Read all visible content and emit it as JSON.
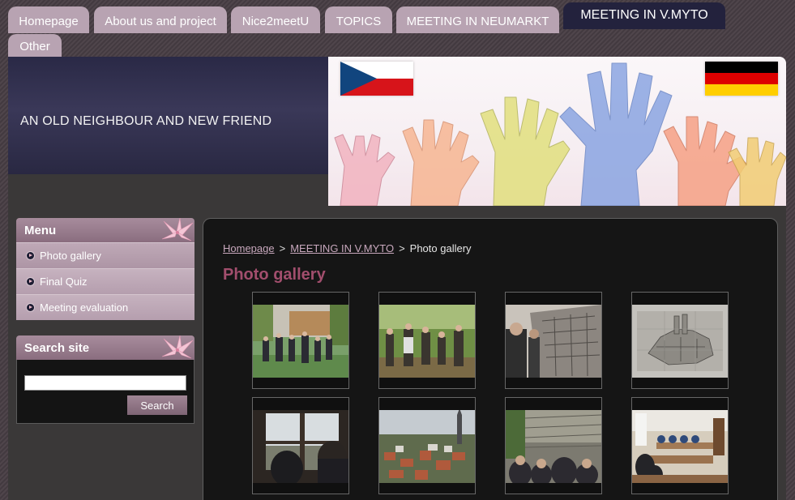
{
  "nav": {
    "tabs": [
      {
        "label": "Homepage",
        "active": false
      },
      {
        "label": "About us and project",
        "active": false
      },
      {
        "label": "Nice2meetU",
        "active": false
      },
      {
        "label": "TOPICS",
        "active": false
      },
      {
        "label": "MEETING IN NEUMARKT",
        "active": false
      },
      {
        "label": "MEETING IN V.MYTO",
        "active": true
      },
      {
        "label": "Other",
        "active": false
      }
    ]
  },
  "header": {
    "tagline": "AN OLD NEIGHBOUR AND NEW FRIEND",
    "banner_flags": [
      "flag-czech-icon",
      "flag-germany-icon"
    ]
  },
  "sidebar": {
    "menu": {
      "title": "Menu",
      "items": [
        {
          "label": "Photo gallery"
        },
        {
          "label": "Final Quiz"
        },
        {
          "label": "Meeting evaluation"
        }
      ]
    },
    "search": {
      "title": "Search site",
      "input_value": "",
      "button_label": "Search"
    }
  },
  "main": {
    "breadcrumb": {
      "items": [
        "Homepage",
        "MEETING IN V.MYTO",
        "Photo gallery"
      ],
      "separator": ">"
    },
    "title": "Photo gallery",
    "gallery": [
      {
        "icon": "photo-group-walking-thumbnail"
      },
      {
        "icon": "photo-group-in-park-thumbnail"
      },
      {
        "icon": "photo-city-model-wall-thumbnail"
      },
      {
        "icon": "photo-city-map-drawing-thumbnail"
      },
      {
        "icon": "photo-window-view-thumbnail"
      },
      {
        "icon": "photo-town-panorama-thumbnail"
      },
      {
        "icon": "photo-students-at-wall-thumbnail"
      },
      {
        "icon": "photo-classroom-thumbnail"
      }
    ]
  },
  "colors": {
    "tab": "#b8a3b2",
    "tab_active": "#23223d",
    "title": "#a24e6d",
    "content_bg": "#151515"
  }
}
